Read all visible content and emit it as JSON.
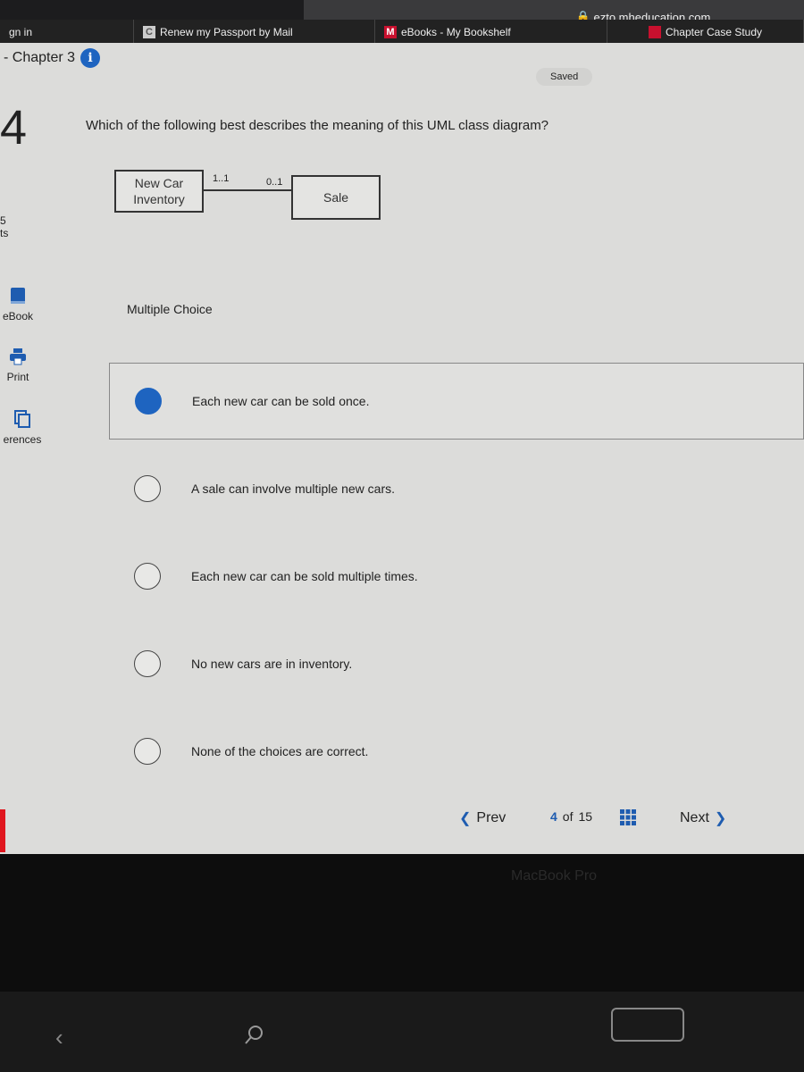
{
  "browser": {
    "url": "ezto.mheducation.com",
    "tabs": [
      {
        "label": "gn in"
      },
      {
        "label": "Renew my Passport by Mail",
        "icon": "C"
      },
      {
        "label": "eBooks - My Bookshelf",
        "icon": "M"
      },
      {
        "label": "Chapter Case Study",
        "icon": "McGraw Hill"
      }
    ]
  },
  "header": {
    "chapter": "- Chapter 3",
    "info_icon": "i",
    "saved": "Saved"
  },
  "sidebar": {
    "question_number": "4",
    "points_value": "5",
    "points_label": "ts",
    "items": [
      {
        "label": "eBook",
        "icon": "book-icon"
      },
      {
        "label": "Print",
        "icon": "printer-icon"
      },
      {
        "label": "erences",
        "icon": "references-icon"
      }
    ]
  },
  "question": {
    "text": "Which of the following best describes the meaning of this UML class diagram?",
    "diagram": {
      "class_a": [
        "New Car",
        "Inventory"
      ],
      "class_b": "Sale",
      "mult_a": "1..1",
      "mult_b": "0..1"
    },
    "type": "Multiple Choice",
    "options": [
      {
        "label": "Each new car can be sold once.",
        "selected": true
      },
      {
        "label": "A sale can involve multiple new cars.",
        "selected": false
      },
      {
        "label": "Each new car can be sold multiple times.",
        "selected": false
      },
      {
        "label": "No new cars are in inventory.",
        "selected": false
      },
      {
        "label": "None of the choices are correct.",
        "selected": false
      }
    ]
  },
  "navigation": {
    "prev": "Prev",
    "current": "4",
    "of": "of",
    "total": "15",
    "next": "Next"
  },
  "colors": {
    "accent": "#1e64c0",
    "alert": "#e0161e"
  },
  "device": {
    "brand": "MacBook Pro"
  }
}
